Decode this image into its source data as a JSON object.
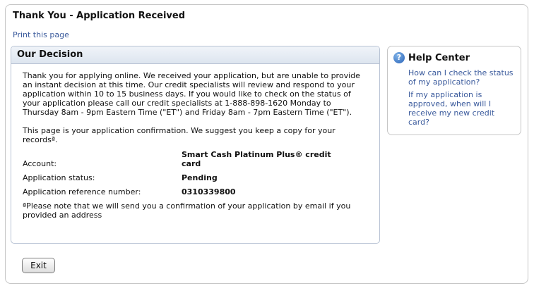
{
  "page": {
    "title": "Thank You - Application Received",
    "print_link": "Print this page"
  },
  "decision": {
    "title": "Our Decision",
    "paragraph1": "Thank you for applying online. We received your application, but are unable to provide an instant decision at this time. Our credit specialists will review and respond to your application within 10 to 15 business days. If you would like to check on the status of your application please call our credit specialists at 1-888-898-1620 Monday to Thursday 8am - 9pm Eastern Time (\"ET\") and Friday 8am - 7pm Eastern Time (\"ET\").",
    "paragraph2": "This page is your application confirmation. We suggest you keep a copy for your recordsª.",
    "details": [
      {
        "label": "Account:",
        "value": "Smart Cash Platinum Plus® credit card"
      },
      {
        "label": "Application status:",
        "value": "Pending"
      },
      {
        "label": "Application reference number:",
        "value": "0310339800"
      }
    ],
    "note": "ªPlease note that we will send you a confirmation of your application by email if you provided an address"
  },
  "help_center": {
    "title": "Help Center",
    "icon": "question-icon",
    "links": [
      "How can I check the status of my application?",
      "If my application is approved, when will I receive my new credit card?"
    ]
  },
  "buttons": {
    "exit": "Exit"
  }
}
